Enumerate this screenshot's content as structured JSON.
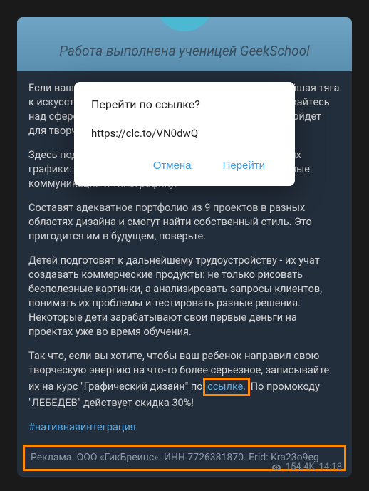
{
  "banner": {
    "text": "Работа выполнена ученицей GeekSchool"
  },
  "message": {
    "p1": "Если вашему ребенку 8-17 лет и у него есть хоть малейшая тяга к искусству или компьютерным технологиям, то задумайтесь над сферой графического дизайна - она идеально подойдет для творческих детей.",
    "p2": "Здесь подростки смогут разобраться во всех тонкостях графики: изучат Figma, Photoshop и Illustrator, визуальные коммуникации и типографику.",
    "p3": "Составят адекватное портфолио из 9 проектов в разных областях дизайна и смогут найти собственный стиль. Это пригодится им в будущем, поверьте.",
    "p4": "Детей подготовят к дальнейшему трудоустройству - их учат создавать коммерческие продукты: не только рисовать бесполезные картинки, а анализировать запросы клиентов, понимать их проблемы и тестировать разные решения. Некоторые дети зарабатывают свои первые деньги на проектах уже во время обучения.",
    "p5_part1": "Так что, если вы хотите, чтобы ваш ребенок направил свою творческую энергию на что-то более серьезное, записывайте их на курс \"Графический дизайн\" по ",
    "p5_link": "ссылке.",
    "p5_part2": " По промокоду \"ЛЕБЕДЕВ\" действует скидка 30%!",
    "hashtag": "#нативнаяинтеграция",
    "disclaimer": "Реклама. ООО «ГикБреинс». ИНН 7726381870. Erid: Kra23o9eg"
  },
  "footer": {
    "views": "154.4K",
    "time": "14:18"
  },
  "dialog": {
    "title": "Перейти по ссылке?",
    "url": "https://clc.to/VN0dwQ",
    "cancel": "Отмена",
    "confirm": "Перейти"
  }
}
